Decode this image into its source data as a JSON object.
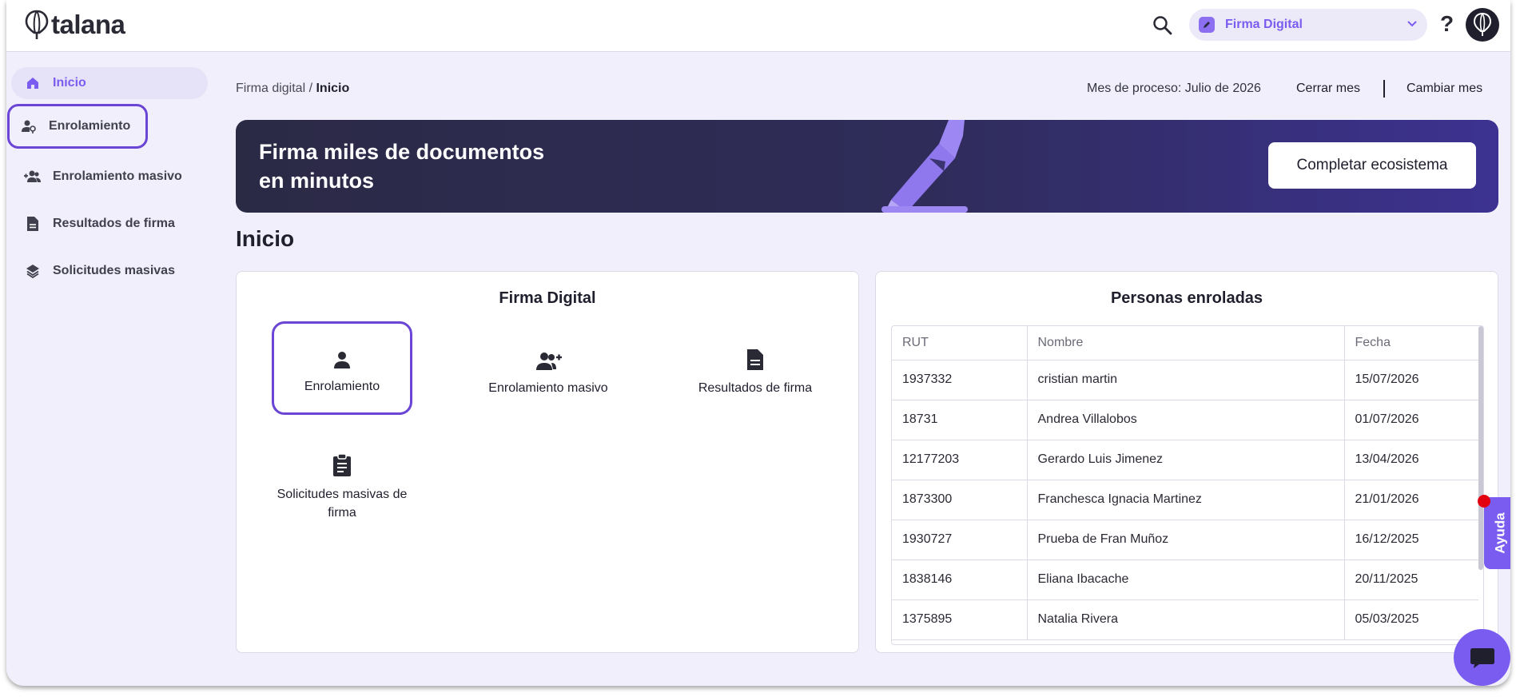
{
  "app": {
    "logo_text": "talana"
  },
  "topbar": {
    "module_label": "Firma Digital",
    "help_label": "?"
  },
  "sidebar": {
    "items": [
      {
        "label": "Inicio"
      },
      {
        "label": "Enrolamiento"
      },
      {
        "label": "Enrolamiento masivo"
      },
      {
        "label": "Resultados de firma"
      },
      {
        "label": "Solicitudes masivas"
      }
    ]
  },
  "breadcrumb": {
    "parent": "Firma digital",
    "separator": " / ",
    "current": "Inicio"
  },
  "process": {
    "month_text": "Mes de proceso: Julio de 2026",
    "close_label": "Cerrar mes",
    "change_label": "Cambiar mes"
  },
  "banner": {
    "line1": "Firma miles de documentos",
    "line2": "en minutos",
    "button_label": "Completar ecosistema"
  },
  "page": {
    "title": "Inicio"
  },
  "firma_card": {
    "title": "Firma Digital",
    "tiles": [
      {
        "label": "Enrolamiento",
        "icon": "person-icon"
      },
      {
        "label": "Enrolamiento masivo",
        "icon": "person-add-icon"
      },
      {
        "label": "Resultados de firma",
        "icon": "document-icon"
      },
      {
        "label": "Solicitudes masivas de firma",
        "icon": "clipboard-icon"
      }
    ]
  },
  "personas_card": {
    "title": "Personas enroladas",
    "columns": [
      "RUT",
      "Nombre",
      "Fecha"
    ],
    "rows": [
      {
        "rut": "1937332",
        "nombre": "cristian martin",
        "fecha": "15/07/2026"
      },
      {
        "rut": "18731",
        "nombre": "Andrea Villalobos",
        "fecha": "01/07/2026"
      },
      {
        "rut": "12177203",
        "nombre": "Gerardo Luis Jimenez",
        "fecha": "13/04/2026"
      },
      {
        "rut": "1873300",
        "nombre": "Franchesca Ignacia Martinez",
        "fecha": "21/01/2026"
      },
      {
        "rut": "1930727",
        "nombre": "Prueba de Fran Muñoz",
        "fecha": "16/12/2025"
      },
      {
        "rut": "1838146",
        "nombre": "Eliana Ibacache",
        "fecha": "20/11/2025"
      },
      {
        "rut": "1375895",
        "nombre": "Natalia Rivera",
        "fecha": "05/03/2025"
      }
    ]
  },
  "floating": {
    "ayuda_label": "Ayuda"
  },
  "colors": {
    "accent": "#7b5cf0",
    "outline": "#6a45d6",
    "background": "#f1effb",
    "notification": "#e3000f"
  }
}
